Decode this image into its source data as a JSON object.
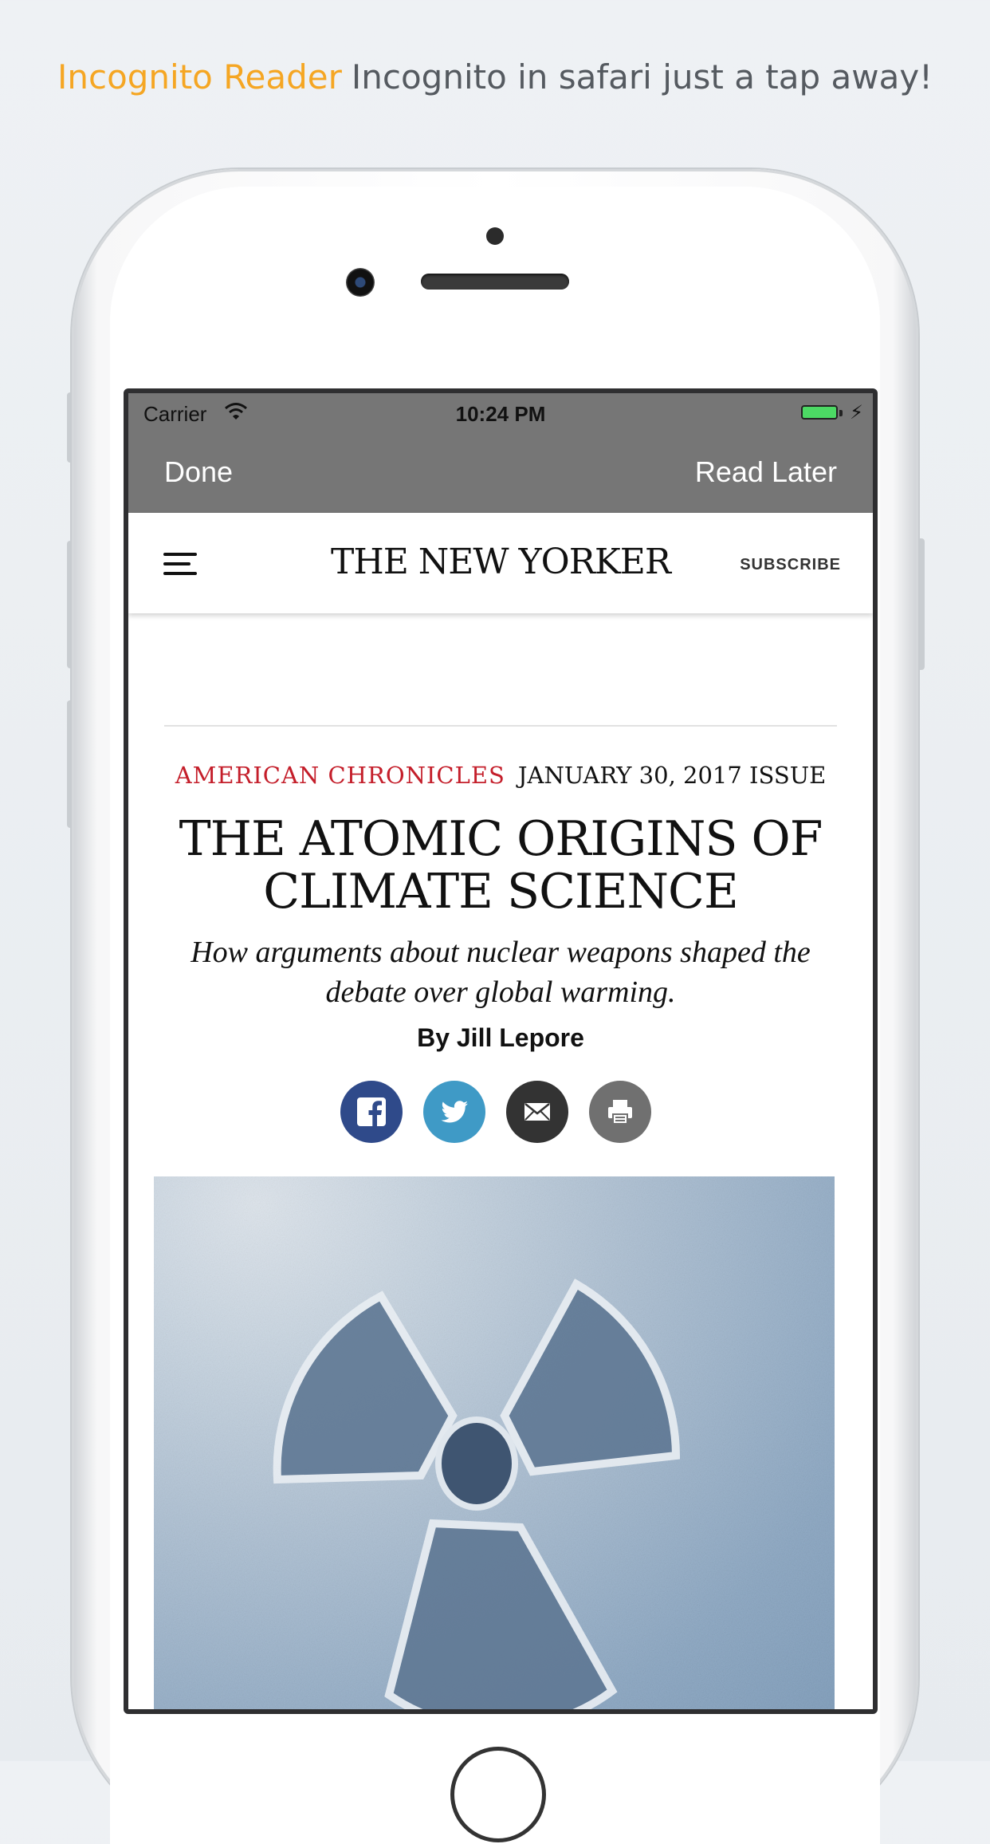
{
  "tagline": {
    "app_name": "Incognito Reader",
    "text": "Incognito in safari just a tap away!",
    "app_color": "#f5a623"
  },
  "status_bar": {
    "carrier": "Carrier",
    "time": "10:24 PM",
    "battery_color": "#4cd964"
  },
  "nav_bar": {
    "done_label": "Done",
    "read_later_label": "Read Later"
  },
  "site_header": {
    "menu_icon": "hamburger-menu-icon",
    "logo": "THE NEW YORKER",
    "subscribe_label": "SUBSCRIBE"
  },
  "article": {
    "rubric": "AMERICAN CHRONICLES",
    "rubric_color": "#c41e2a",
    "issue": "JANUARY 30, 2017 ISSUE",
    "headline_line1": "THE ATOMIC ORIGINS OF",
    "headline_line2": "CLIMATE SCIENCE",
    "dek": "How arguments about nuclear weapons shaped the debate over global warming.",
    "byline": "By Jill Lepore"
  },
  "share_buttons": [
    {
      "icon": "facebook-icon",
      "color": "#2f4a8a"
    },
    {
      "icon": "twitter-icon",
      "color": "#3f9ac6"
    },
    {
      "icon": "email-icon",
      "color": "#333333"
    },
    {
      "icon": "print-icon",
      "color": "#707070"
    }
  ],
  "hero_image": {
    "subject": "radiation-symbol-in-snow"
  }
}
